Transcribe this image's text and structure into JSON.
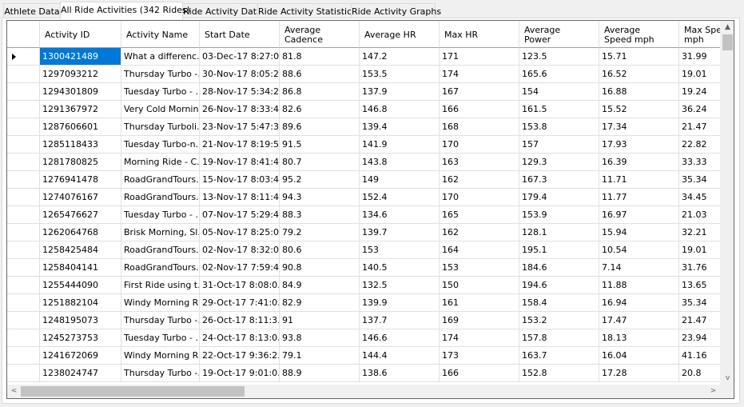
{
  "tabs": [
    {
      "label": "Athlete Data"
    },
    {
      "label": "All Ride Activities (342 Rides)"
    },
    {
      "label": "Ride Activity Data"
    },
    {
      "label": "Ride Activity Statistics"
    },
    {
      "label": "Ride Activity Graphs"
    }
  ],
  "active_tab": 1,
  "grid": {
    "columns": [
      "Activity ID",
      "Activity Name",
      "Start Date",
      "Average\nCadence",
      "Average HR",
      "Max HR",
      "Average\nPower",
      "Average\nSpeed mph",
      "Max Spe\nmph"
    ],
    "rows": [
      [
        "1300421489",
        "What a differenc...",
        "03-Dec-17 8:27:0...",
        "81.8",
        "147.2",
        "171",
        "123.5",
        "15.71",
        "31.99"
      ],
      [
        "1297093212",
        "Thursday Turbo -...",
        "30-Nov-17 8:05:2...",
        "88.6",
        "153.5",
        "174",
        "165.6",
        "16.52",
        "19.01"
      ],
      [
        "1294301809",
        "Tuesday Turbo - ...",
        "28-Nov-17 5:34:2...",
        "86.8",
        "137.9",
        "167",
        "154",
        "16.88",
        "19.24"
      ],
      [
        "1291367972",
        "Very Cold Mornin...",
        "26-Nov-17 8:33:4...",
        "82.6",
        "146.8",
        "166",
        "161.5",
        "15.52",
        "36.24"
      ],
      [
        "1287606601",
        "Thursday Turboli...",
        "23-Nov-17 5:47:3...",
        "89.6",
        "139.4",
        "168",
        "153.8",
        "17.34",
        "21.47"
      ],
      [
        "1285118433",
        "Tuesday Turbo-n...",
        "21-Nov-17 8:19:5...",
        "91.5",
        "141.9",
        "170",
        "157",
        "17.93",
        "22.82"
      ],
      [
        "1281780825",
        "Morning Ride - C...",
        "19-Nov-17 8:41:4...",
        "80.7",
        "143.8",
        "163",
        "129.3",
        "16.39",
        "33.33"
      ],
      [
        "1276941478",
        "RoadGrandTours...",
        "15-Nov-17 8:03:4...",
        "95.2",
        "149",
        "162",
        "167.3",
        "11.71",
        "35.34"
      ],
      [
        "1274076167",
        "RoadGrandTours...",
        "13-Nov-17 8:11:4...",
        "94.3",
        "152.4",
        "170",
        "179.4",
        "11.77",
        "34.45"
      ],
      [
        "1265476627",
        "Tuesday Turbo - ...",
        "07-Nov-17 5:29:4...",
        "88.3",
        "134.6",
        "165",
        "153.9",
        "16.97",
        "21.03"
      ],
      [
        "1262064768",
        "Brisk Morning, Sl...",
        "05-Nov-17 8:25:0...",
        "79.2",
        "139.7",
        "162",
        "128.1",
        "15.94",
        "32.21"
      ],
      [
        "1258425484",
        "RoadGrandTours...",
        "02-Nov-17 8:32:0...",
        "80.6",
        "153",
        "164",
        "195.1",
        "10.54",
        "19.01"
      ],
      [
        "1258404141",
        "RoadGrandTours...",
        "02-Nov-17 7:59:4...",
        "90.8",
        "140.5",
        "153",
        "184.6",
        "7.14",
        "31.76"
      ],
      [
        "1255444090",
        "First Ride using t...",
        "31-Oct-17 8:08:0...",
        "84.9",
        "132.5",
        "150",
        "194.6",
        "11.88",
        "13.65"
      ],
      [
        "1251882104",
        "Windy Morning R...",
        "29-Oct-17 7:41:0...",
        "82.9",
        "139.9",
        "161",
        "158.4",
        "16.94",
        "35.34"
      ],
      [
        "1248195073",
        "Thursday Turbo -...",
        "26-Oct-17 8:11:3...",
        "91",
        "137.7",
        "169",
        "153.2",
        "17.47",
        "21.47"
      ],
      [
        "1245273753",
        "Tuesday Turbo - ...",
        "24-Oct-17 8:13:0...",
        "93.8",
        "146.6",
        "174",
        "157.8",
        "18.13",
        "23.94"
      ],
      [
        "1241672069",
        "Windy Morning R...",
        "22-Oct-17 9:36:2...",
        "79.1",
        "144.4",
        "173",
        "163.7",
        "16.04",
        "41.16"
      ],
      [
        "1238024747",
        "Thursday Turbo -...",
        "19-Oct-17 9:01:0...",
        "88.9",
        "138.6",
        "166",
        "152.8",
        "17.28",
        "20.8"
      ]
    ],
    "selected_row": 0
  },
  "scroll": {
    "up_arrow": "▲",
    "down_arrow": "v",
    "left_arrow": "<",
    "right_arrow": ">"
  }
}
